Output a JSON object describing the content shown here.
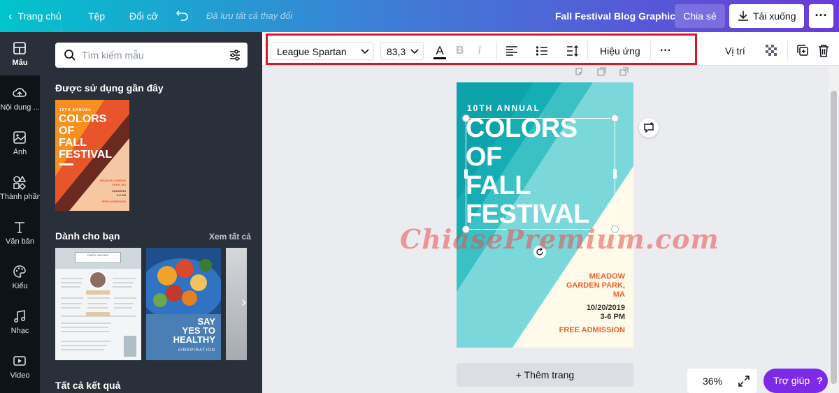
{
  "topbar": {
    "home": "Trang chủ",
    "file": "Tệp",
    "resize": "Đổi cỡ",
    "saved_status": "Đã lưu tất cả thay đổi",
    "doc_title": "Fall Festival Blog Graphic",
    "share": "Chia sẻ",
    "download": "Tải xuống"
  },
  "rail": {
    "templates": "Mẫu",
    "uploads": "Nội dung ...",
    "photos": "Ảnh",
    "elements": "Thành phần",
    "text": "Văn bản",
    "styles": "Kiểu",
    "music": "Nhạc",
    "video": "Video"
  },
  "panel": {
    "search_placeholder": "Tìm kiếm mẫu",
    "recent_title": "Được sử dụng gần đây",
    "for_you_title": "Dành cho bạn",
    "see_all": "Xem tất cả",
    "all_results_title": "Tất cả kết quả",
    "thumb_fall": {
      "annual": "10TH ANNUAL",
      "lines": [
        "COLORS",
        "OF",
        "FALL",
        "FESTIVAL"
      ],
      "venue": "MEADOW GARDEN PARK, MA",
      "date": "10/20/2019",
      "time": "3-6 PM",
      "admission": "FREE ADMISSION"
    },
    "thumb_resume_name": "CAROL PAYNES",
    "thumb_salad": {
      "line1": "SAY",
      "line2": "YES TO",
      "line3": "HEALTHY",
      "tag": "#INSPIRATION"
    }
  },
  "toolbar": {
    "font": "League Spartan",
    "size": "83,3",
    "effects": "Hiệu ứng",
    "position": "Vị trí"
  },
  "design": {
    "annual": "10TH ANNUAL",
    "title_lines": [
      "COLORS",
      "OF",
      "FALL",
      "FESTIVAL"
    ],
    "venue_line1": "MEADOW",
    "venue_line2": "GARDEN PARK,",
    "venue_line3": "MA",
    "date": "10/20/2019",
    "time": "3-6 PM",
    "admission": "FREE ADMISSION"
  },
  "watermark": "ChiasePremium.com",
  "footer": {
    "add_page": "+ Thêm trang",
    "zoom": "36%",
    "help": "Trợ giúp"
  },
  "colors": {
    "teal": "#00c4cc",
    "purple": "#7d2ae8",
    "design_orange": "#e8632a",
    "highlight_red": "#d8162a"
  }
}
